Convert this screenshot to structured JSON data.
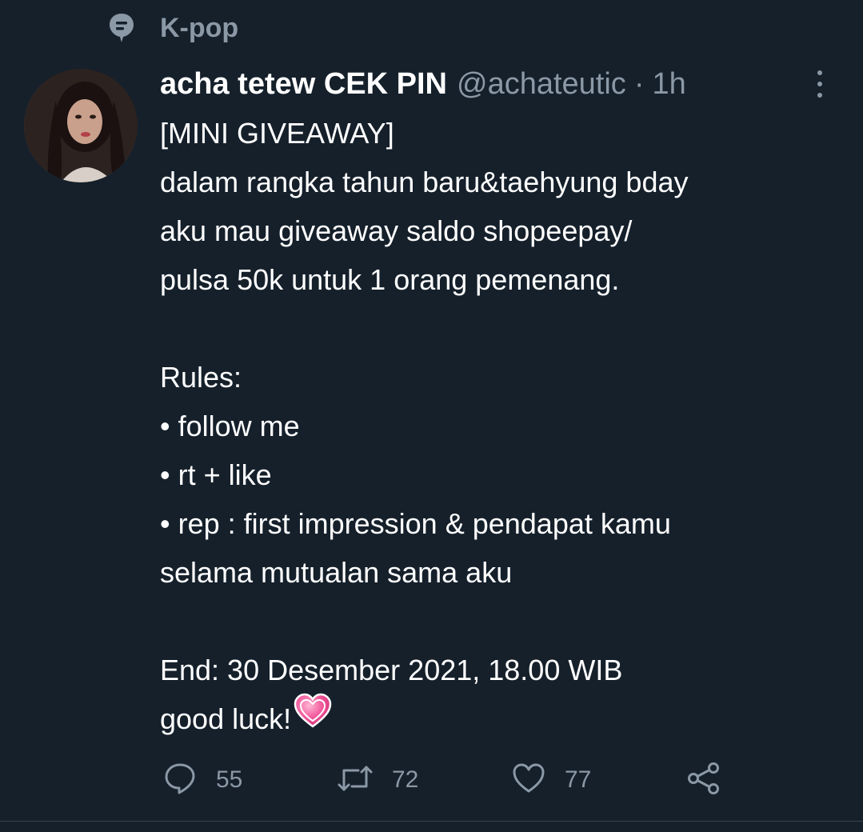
{
  "topic": {
    "icon": "topic-icon",
    "label": "K-pop"
  },
  "tweet": {
    "display_name": "acha tetew CEK PIN",
    "handle": "@achateutic",
    "separator": "·",
    "time": "1h",
    "lines": [
      "[MINI GIVEAWAY]",
      "dalam rangka tahun baru&taehyung bday",
      "aku mau giveaway saldo shopeepay/",
      "pulsa 50k untuk 1 orang pemenang.",
      "",
      "Rules:",
      "• follow me",
      "• rt + like",
      "• rep : first impression & pendapat kamu",
      "selama mutualan sama aku",
      "",
      "End: 30 Desember 2021, 18.00 WIB",
      "good luck!"
    ],
    "trailing_emoji": "heart-emoji"
  },
  "actions": {
    "reply_count": "55",
    "retweet_count": "72",
    "like_count": "77"
  },
  "colors": {
    "background": "#15202b",
    "text": "#ffffff",
    "muted": "#8b98a5",
    "heart": "#f0579a"
  }
}
